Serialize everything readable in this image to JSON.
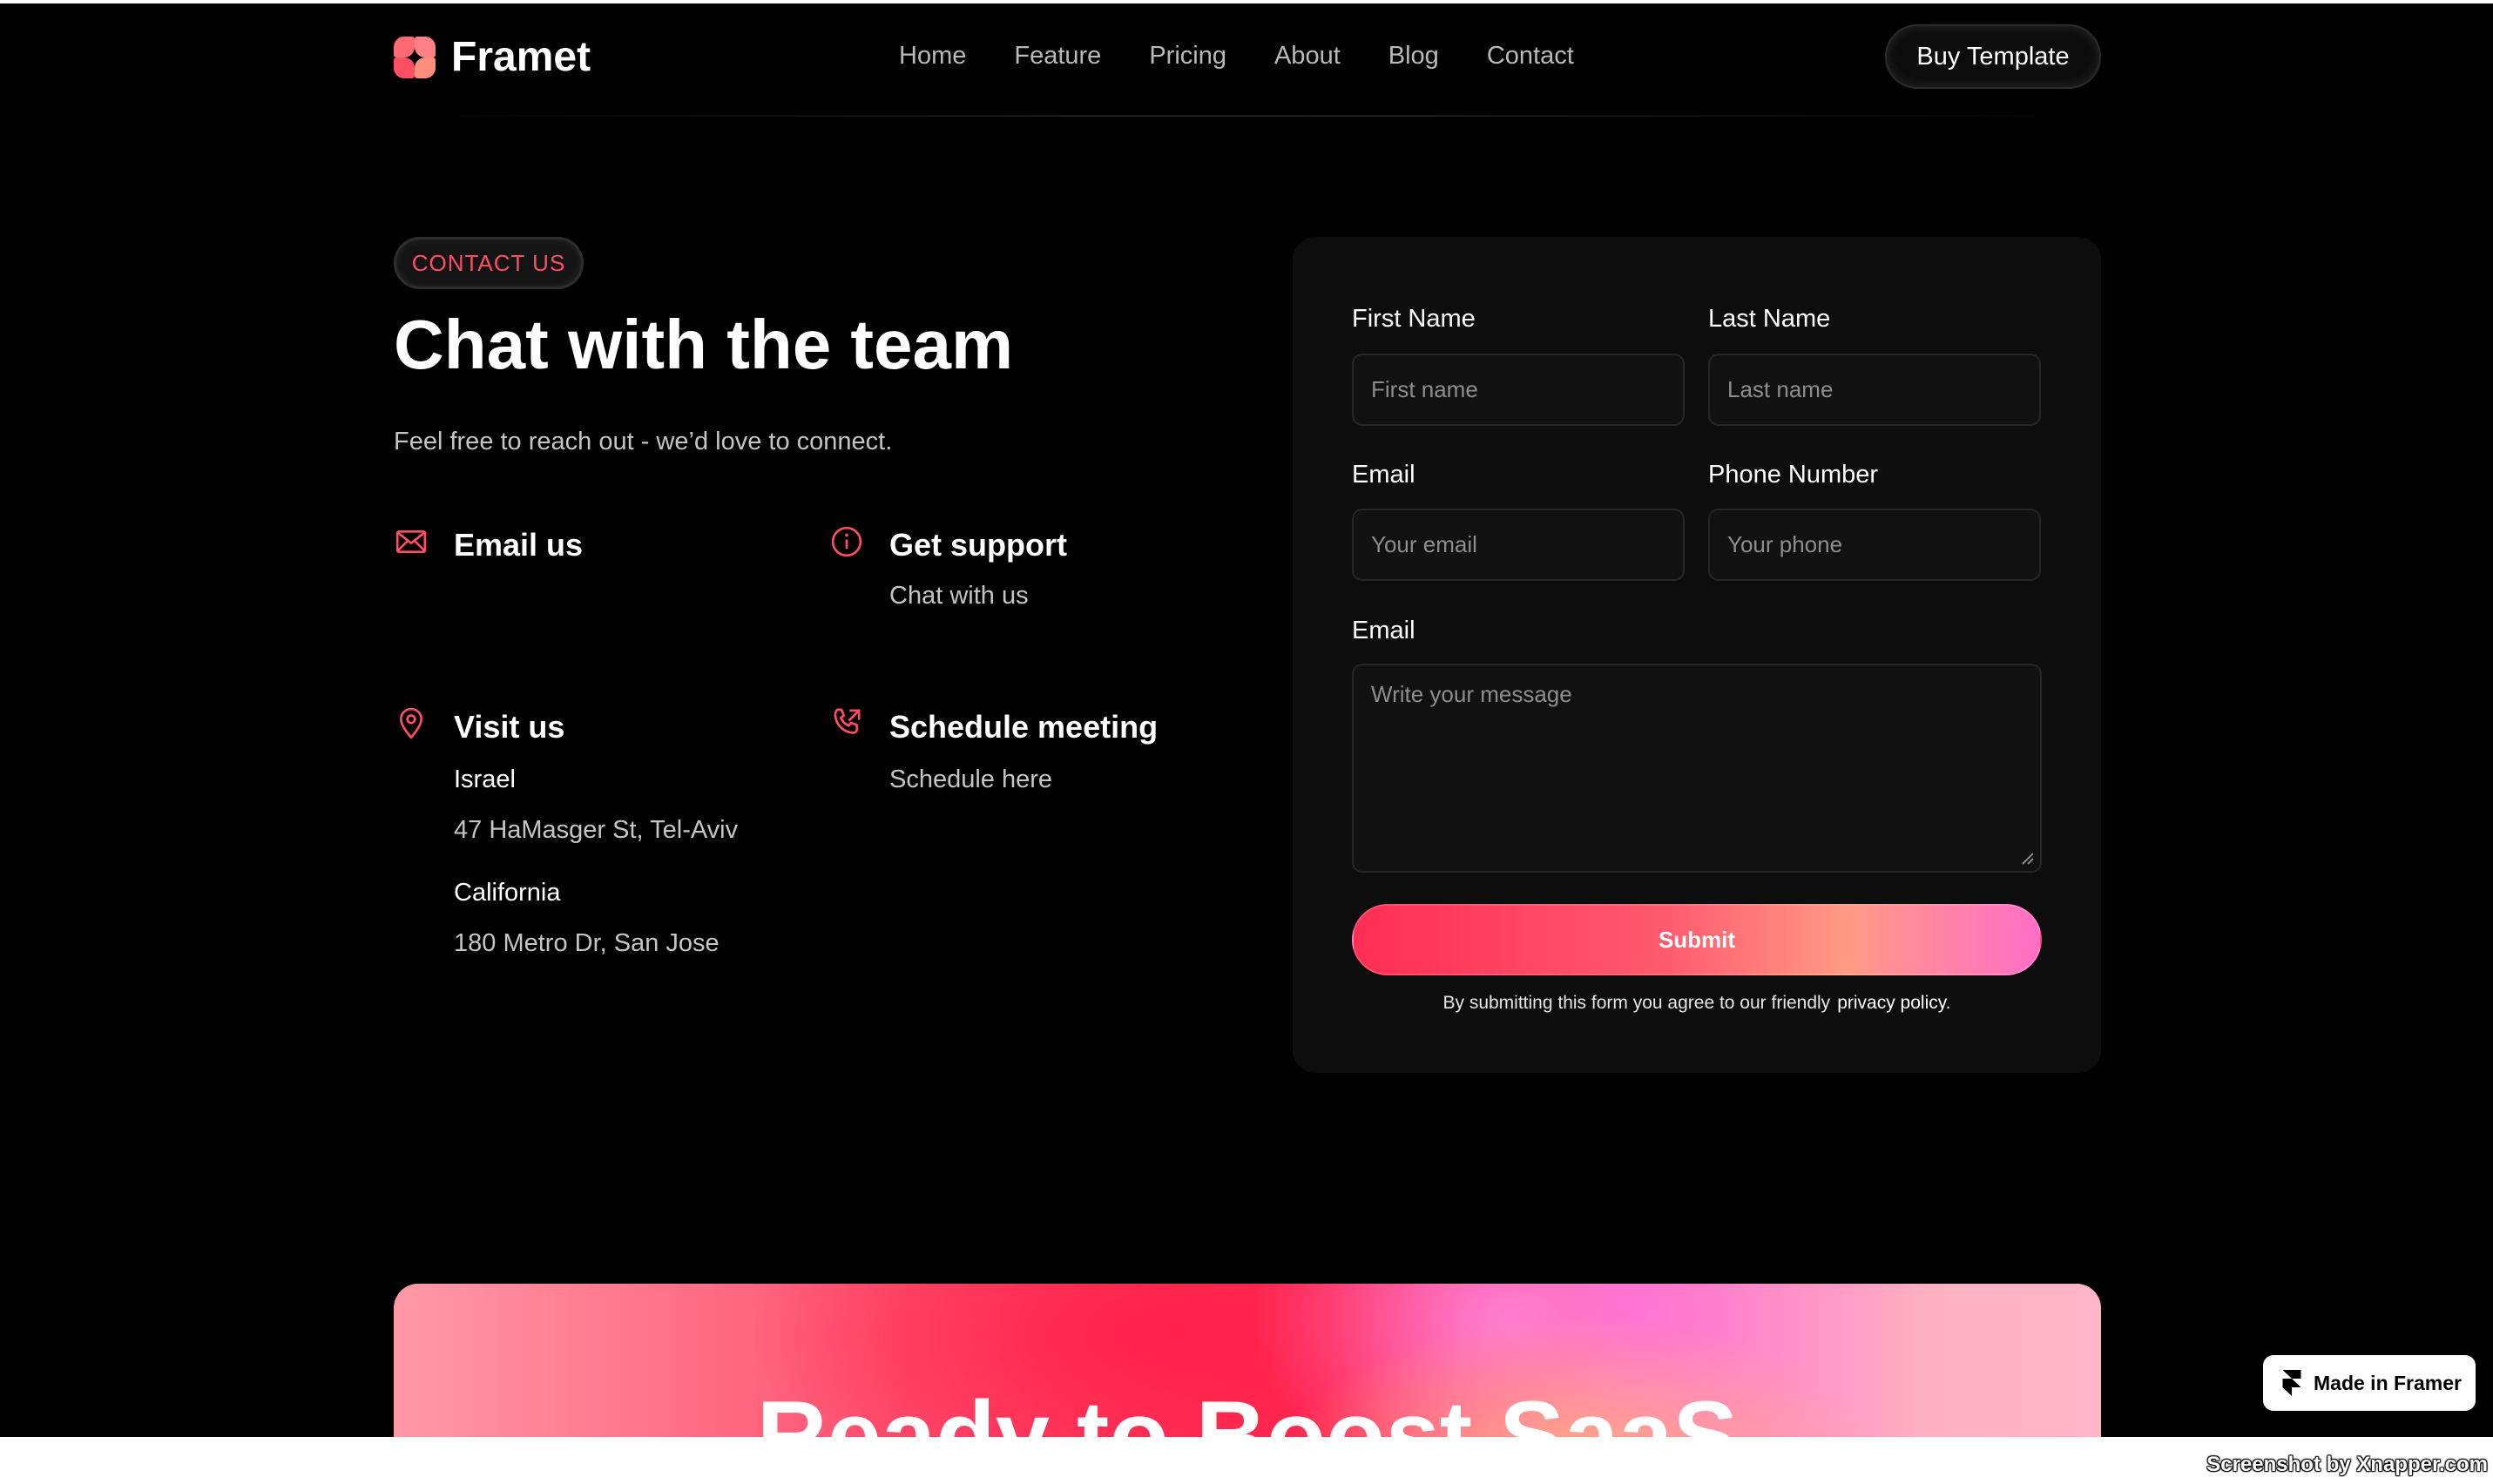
{
  "brand": {
    "name": "Framet",
    "logo_icon": "flower-logo-icon",
    "accent": "#ff4d63"
  },
  "nav": {
    "items": [
      "Home",
      "Feature",
      "Pricing",
      "About",
      "Blog",
      "Contact"
    ],
    "cta_label": "Buy Template"
  },
  "hero": {
    "badge": "CONTACT US",
    "title": "Chat with the team",
    "subtitle": "Feel free to reach out - we’d love to connect."
  },
  "contact_items": {
    "email": {
      "icon": "mail-icon",
      "title": "Email us"
    },
    "support": {
      "icon": "info-icon",
      "title": "Get support",
      "sub": "Chat with us"
    },
    "visit": {
      "icon": "map-pin-icon",
      "title": "Visit us",
      "locations": [
        {
          "region": "Israel",
          "address": "47 HaMasger St, Tel-Aviv"
        },
        {
          "region": "California",
          "address": "180 Metro Dr, San Jose"
        }
      ]
    },
    "meeting": {
      "icon": "phone-outgoing-icon",
      "title": "Schedule meeting",
      "sub": "Schedule here"
    }
  },
  "form": {
    "first_name": {
      "label": "First Name",
      "placeholder": "First name",
      "value": ""
    },
    "last_name": {
      "label": "Last Name",
      "placeholder": "Last name",
      "value": ""
    },
    "email": {
      "label": "Email",
      "placeholder": "Your email",
      "value": ""
    },
    "phone": {
      "label": "Phone Number",
      "placeholder": "Your phone",
      "value": ""
    },
    "message": {
      "label": "Email",
      "placeholder": "Write your message",
      "value": ""
    },
    "submit_label": "Submit",
    "terms_text": "By submitting this form you agree to our friendly",
    "terms_link": "privacy policy."
  },
  "cta": {
    "title": "Ready to Boost SaaS"
  },
  "framer_badge": {
    "label": "Made in Framer",
    "icon": "framer-icon"
  },
  "watermark": "Screenshot by Xnapper.com"
}
